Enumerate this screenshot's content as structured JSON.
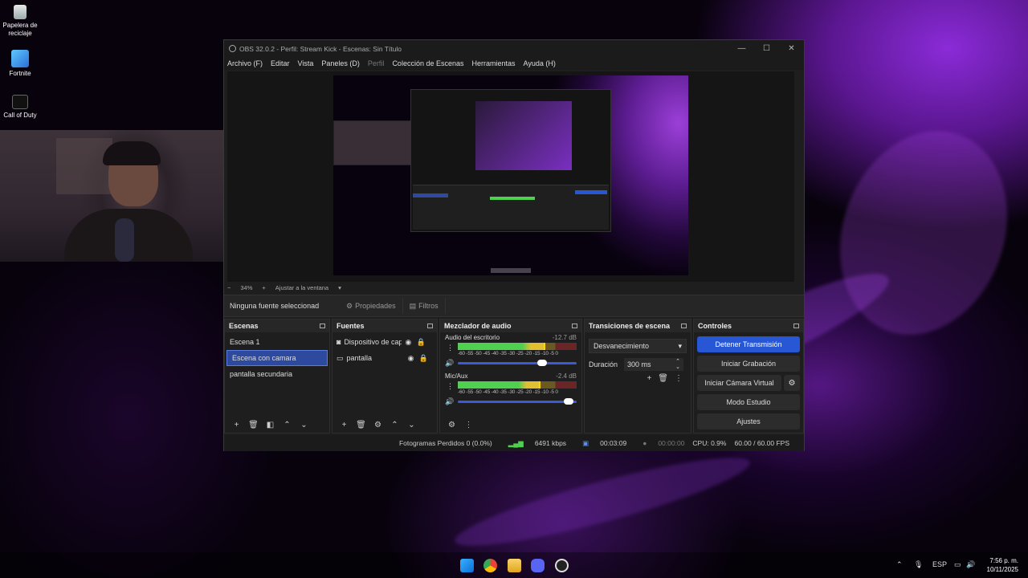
{
  "desktop": {
    "icons": [
      {
        "label": "Papelera de reciclaje",
        "icon": "recycle-bin-icon"
      },
      {
        "label": "Fortnite",
        "icon": "fortnite-icon"
      },
      {
        "label": "Call of Duty",
        "icon": "call-of-duty-icon"
      }
    ]
  },
  "obs": {
    "title": "OBS 32.0.2 - Perfil: Stream Kick - Escenas: Sin Título",
    "window_controls": {
      "minimize": "—",
      "maximize": "☐",
      "close": "✕"
    },
    "menu": [
      "Archivo (F)",
      "Editar",
      "Vista",
      "Paneles (D)",
      "Perfil",
      "Colección de Escenas",
      "Herramientas",
      "Ayuda (H)"
    ],
    "zoom": {
      "minus": "−",
      "value": "34%",
      "plus": "+",
      "fit": "Ajustar a la ventana"
    },
    "source_toolbar": {
      "none_selected": "Ninguna fuente seleccionad",
      "properties": "Propiedades",
      "filters": "Filtros"
    },
    "scenes": {
      "title": "Escenas",
      "items": [
        "Escena 1",
        "Escena con camara",
        "pantalla secundaria"
      ],
      "selected": "Escena con camara"
    },
    "sources": {
      "title": "Fuentes",
      "items": [
        {
          "name": "Dispositivo de captura",
          "icon": "camera-icon"
        },
        {
          "name": "pantalla",
          "icon": "monitor-icon"
        }
      ]
    },
    "mixer": {
      "title": "Mezclador de audio",
      "channels": [
        {
          "name": "Audio del escritorio",
          "db": "-12.7 dB",
          "level": 0.72,
          "volume": 0.75
        },
        {
          "name": "Mic/Aux",
          "db": "-2.4 dB",
          "level": 0.68,
          "volume": 0.97
        }
      ],
      "ticks": "-60 -55 -50 -45 -40 -35 -30 -25 -20 -15 -10 -5  0"
    },
    "transitions": {
      "title": "Transiciones de escena",
      "selected": "Desvanecimiento",
      "duration_label": "Duración",
      "duration": "300 ms"
    },
    "controls": {
      "title": "Controles",
      "stop_stream": "Detener Transmisión",
      "start_recording": "Iniciar Grabación",
      "start_virtual_cam": "Iniciar Cámara Virtual",
      "studio_mode": "Modo Estudio",
      "settings": "Ajustes"
    },
    "status": {
      "dropped_frames": "Fotogramas Perdidos 0 (0.0%)",
      "bitrate": "6491 kbps",
      "stream_time": "00:03:09",
      "rec_time": "00:00:00",
      "cpu": "CPU: 0.9%",
      "fps": "60.00 / 60.00 FPS"
    }
  },
  "taskbar": {
    "apps": [
      "windows-start-icon",
      "chrome-icon",
      "file-explorer-icon",
      "discord-icon",
      "obs-icon"
    ],
    "tray": {
      "language": "ESP"
    },
    "clock": {
      "time": "7:56 p. m.",
      "date": "10/11/2025"
    }
  },
  "colors": {
    "accent": "#2857d6",
    "selection": "#2e4a9e",
    "bg": "#1e1e1e"
  }
}
